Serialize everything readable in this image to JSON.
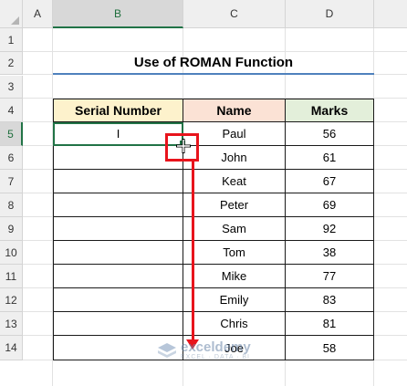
{
  "columns": [
    "A",
    "B",
    "C",
    "D"
  ],
  "rows": [
    "1",
    "2",
    "3",
    "4",
    "5",
    "6",
    "7",
    "8",
    "9",
    "10",
    "11",
    "12",
    "13",
    "14"
  ],
  "title": "Use of ROMAN Function",
  "table": {
    "headers": [
      "Serial Number",
      "Name",
      "Marks"
    ],
    "header_colors": [
      "#fdf2cc",
      "#fbe2d5",
      "#e3efda"
    ],
    "rows": [
      {
        "serial": "I",
        "name": "Paul",
        "marks": "56"
      },
      {
        "serial": "",
        "name": "John",
        "marks": "61"
      },
      {
        "serial": "",
        "name": "Keat",
        "marks": "67"
      },
      {
        "serial": "",
        "name": "Peter",
        "marks": "69"
      },
      {
        "serial": "",
        "name": "Sam",
        "marks": "92"
      },
      {
        "serial": "",
        "name": "Tom",
        "marks": "38"
      },
      {
        "serial": "",
        "name": "Mike",
        "marks": "77"
      },
      {
        "serial": "",
        "name": "Emily",
        "marks": "83"
      },
      {
        "serial": "",
        "name": "Chris",
        "marks": "81"
      },
      {
        "serial": "",
        "name": "Joe",
        "marks": "58"
      }
    ]
  },
  "selected_cell": "B5",
  "annotation_color": "#e8141c",
  "watermark": {
    "name": "exceldemy",
    "tagline": "EXCEL · DATA · BI"
  }
}
